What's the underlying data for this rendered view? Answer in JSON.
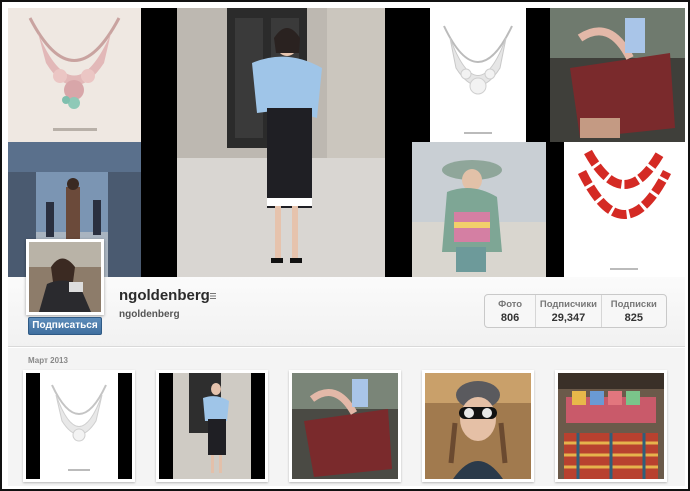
{
  "profile": {
    "username": "ngoldenberg",
    "full_name": "ngoldenberg",
    "follow_label": "Подписаться"
  },
  "stats": [
    {
      "label": "Фото",
      "value": "806"
    },
    {
      "label": "Подписчики",
      "value": "29,347"
    },
    {
      "label": "Подписки",
      "value": "825"
    }
  ],
  "feed": {
    "month": "Март 2013"
  },
  "icons": {
    "menu": "menu-icon"
  },
  "colors": {
    "follow_button": "#4a7aab",
    "necklace_red": "#d42a24",
    "coat_blue": "#9fc5e8"
  }
}
